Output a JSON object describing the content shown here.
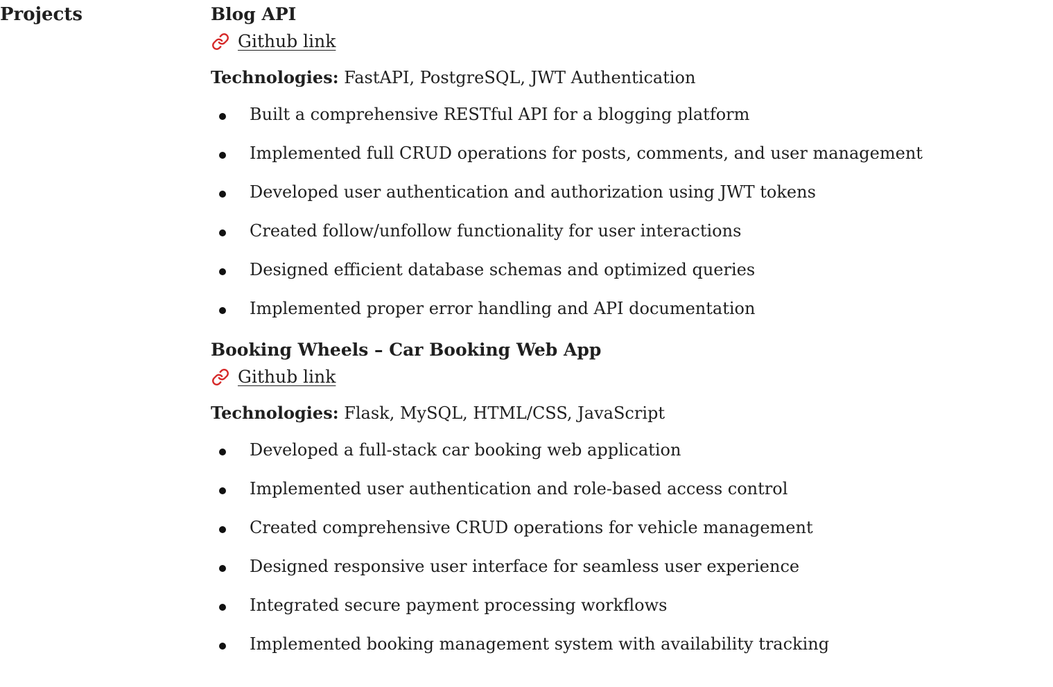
{
  "section": {
    "label": "Projects"
  },
  "icons": {
    "link": "link-icon"
  },
  "colors": {
    "link_icon": "#d62828",
    "text": "#1f1f1f"
  },
  "projects": [
    {
      "title": "Blog API",
      "link_text": "Github link",
      "technologies_label": "Technologies:",
      "technologies": "FastAPI, PostgreSQL, JWT Authentication",
      "bullets": [
        "Built a comprehensive RESTful API for a blogging platform",
        "Implemented full CRUD operations for posts, comments, and user management",
        "Developed user authentication and authorization using JWT tokens",
        "Created follow/unfollow functionality for user interactions",
        "Designed efficient database schemas and optimized queries",
        "Implemented proper error handling and API documentation"
      ]
    },
    {
      "title": "Booking Wheels – Car Booking Web App",
      "link_text": "Github link",
      "technologies_label": "Technologies:",
      "technologies": "Flask, MySQL, HTML/CSS, JavaScript",
      "bullets": [
        "Developed a full-stack car booking web application",
        "Implemented user authentication and role-based access control",
        "Created comprehensive CRUD operations for vehicle management",
        "Designed responsive user interface for seamless user experience",
        "Integrated secure payment processing workflows",
        "Implemented booking management system with availability tracking"
      ]
    }
  ]
}
